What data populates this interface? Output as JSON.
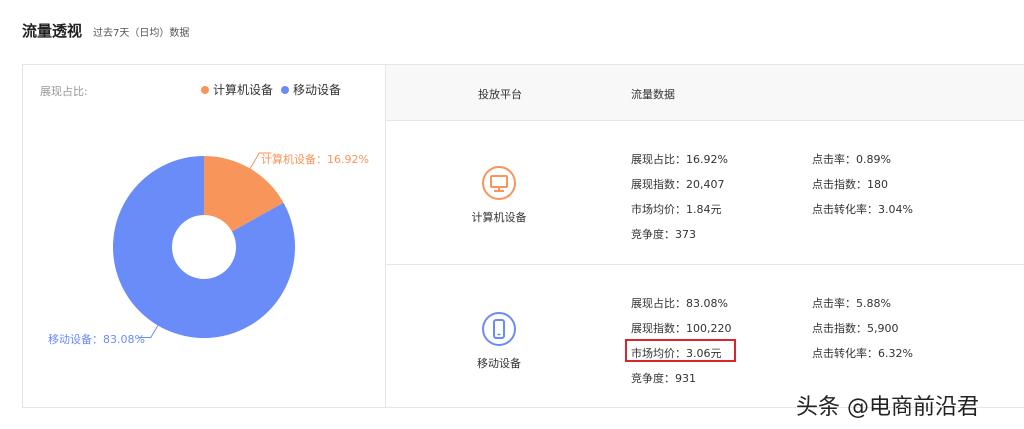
{
  "header": {
    "title": "流量透视",
    "subtitle": "过去7天（日均）数据"
  },
  "share_panel": {
    "label": "展现占比:",
    "legend": [
      {
        "name": "计算机设备",
        "color": "#f7955b"
      },
      {
        "name": "移动设备",
        "color": "#6a8cf8"
      }
    ],
    "pie_labels": {
      "pc": "计算机设备：16.92%",
      "mobile": "移动设备：83.08%"
    }
  },
  "chart_data": {
    "type": "pie",
    "donut": true,
    "categories": [
      "计算机设备",
      "移动设备"
    ],
    "values": [
      16.92,
      83.08
    ],
    "colors": [
      "#f7955b",
      "#6a8cf8"
    ]
  },
  "table": {
    "headers": {
      "platform": "投放平台",
      "data": "流量数据"
    },
    "rows": [
      {
        "platform": "计算机设备",
        "icon": "desktop-icon",
        "color": "#f7955b",
        "stats": {
          "share": "展现占比：16.92%",
          "impressions": "展现指数：20,407",
          "avg_price": "市场均价：1.84元",
          "competition": "竞争度：373",
          "ctr": "点击率：0.89%",
          "clicks": "点击指数：180",
          "cvr": "点击转化率：3.04%"
        }
      },
      {
        "platform": "移动设备",
        "icon": "mobile-phone-icon",
        "color": "#6a8cf8",
        "stats": {
          "share": "展现占比：83.08%",
          "impressions": "展现指数：100,220",
          "avg_price": "市场均价：3.06元",
          "competition": "竞争度：931",
          "ctr": "点击率：5.88%",
          "clicks": "点击指数：5,900",
          "cvr": "点击转化率：6.32%"
        }
      }
    ]
  },
  "watermark": "头条 @电商前沿君"
}
